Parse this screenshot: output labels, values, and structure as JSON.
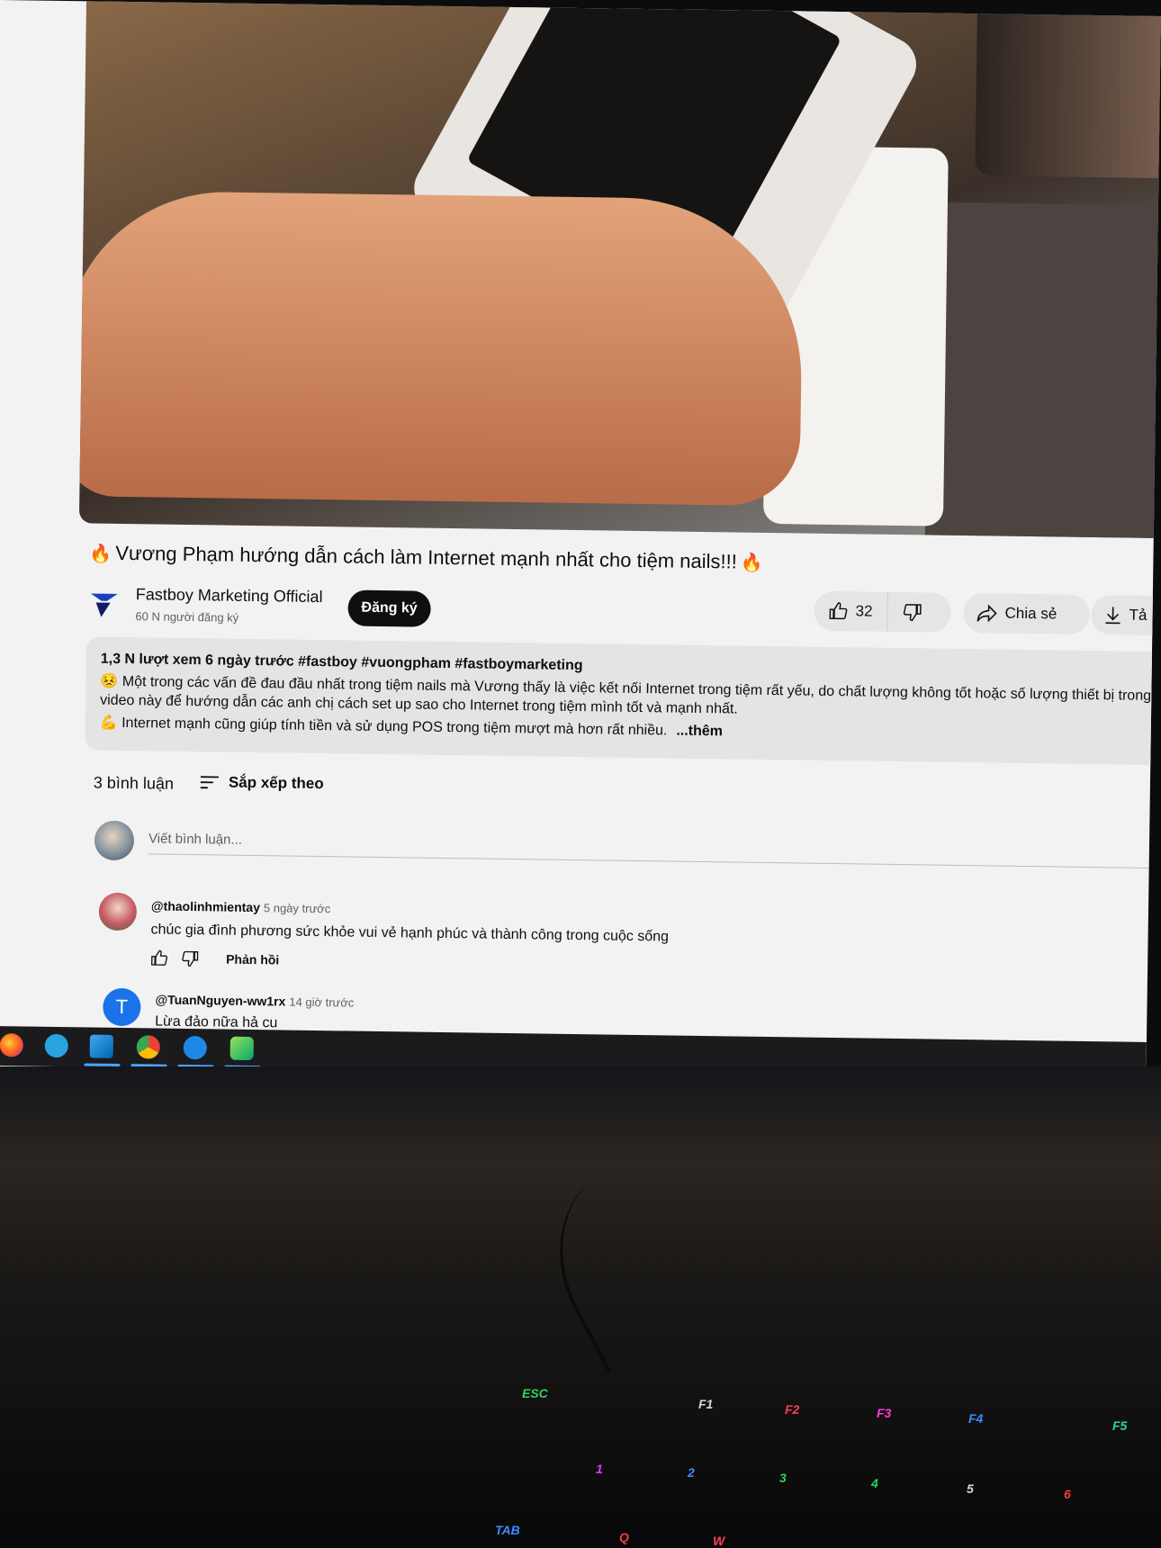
{
  "video": {
    "title": "Vương Phạm hướng dẫn cách làm Internet mạnh nhất cho tiệm nails!!!",
    "title_emoji": "🔥"
  },
  "channel": {
    "name": "Fastboy Marketing Official",
    "subscribers": "60 N người đăng ký",
    "subscribe_label": "Đăng ký"
  },
  "actions": {
    "like_count": "32",
    "share_label": "Chia sẻ",
    "download_label": "Tả"
  },
  "description": {
    "meta": "1,3 N lượt xem  6 ngày trước  #fastboy #vuongpham #fastboymarketing",
    "line1": "😣 Một trong các vấn đề đau đầu nhất trong tiệm nails mà Vương thấy là việc kết nối Internet trong tiệm rất yếu, do chất lượng không tốt hoặc số lượng thiết bị trong",
    "line2": "video này để hướng dẫn các anh chị cách set up sao cho Internet trong tiệm mình tốt và mạnh nhất.",
    "line3": "💪 Internet mạnh cũng giúp tính tiền và sử dụng POS trong tiệm mượt mà hơn rất nhiều.",
    "more_label": "...thêm"
  },
  "comments_header": {
    "count_label": "3 bình luận",
    "sort_label": "Sắp xếp theo"
  },
  "comment_input": {
    "placeholder": "Viết bình luận..."
  },
  "comments": [
    {
      "author": "@thaolinhmientay",
      "time": "5 ngày trước",
      "text": "chúc gia đình phương sức khỏe vui vẻ hạnh phúc và thành công trong cuộc sống",
      "reply_label": "Phản hồi"
    },
    {
      "author": "@TuanNguyen-ww1rx",
      "time": "14 giờ trước",
      "text": "Lừa đảo nữa hả cu",
      "avatar_letter": "T"
    }
  ],
  "taskbar_apps": [
    "firefox-icon",
    "telegram-icon",
    "vscode-icon",
    "chrome-icon",
    "messenger-icon",
    "app-icon"
  ],
  "keyboard_keys": [
    {
      "label": "ESC",
      "color": "#2fd35a"
    },
    {
      "label": "F1",
      "color": "#d9d9d9"
    },
    {
      "label": "F2",
      "color": "#ff3b5c"
    },
    {
      "label": "F3",
      "color": "#ff3bd8"
    },
    {
      "label": "F4",
      "color": "#3b8cff"
    },
    {
      "label": "F5",
      "color": "#2fd3a0"
    },
    {
      "label": "1",
      "color": "#d63bff"
    },
    {
      "label": "2",
      "color": "#3b8cff"
    },
    {
      "label": "3",
      "color": "#2fd35a"
    },
    {
      "label": "4",
      "color": "#2fd35a"
    },
    {
      "label": "5",
      "color": "#d9d9d9"
    },
    {
      "label": "6",
      "color": "#ff3b3b"
    },
    {
      "label": "TAB",
      "color": "#3b8cff"
    },
    {
      "label": "Q",
      "color": "#ff3b3b"
    },
    {
      "label": "W",
      "color": "#ff3b5c"
    }
  ]
}
